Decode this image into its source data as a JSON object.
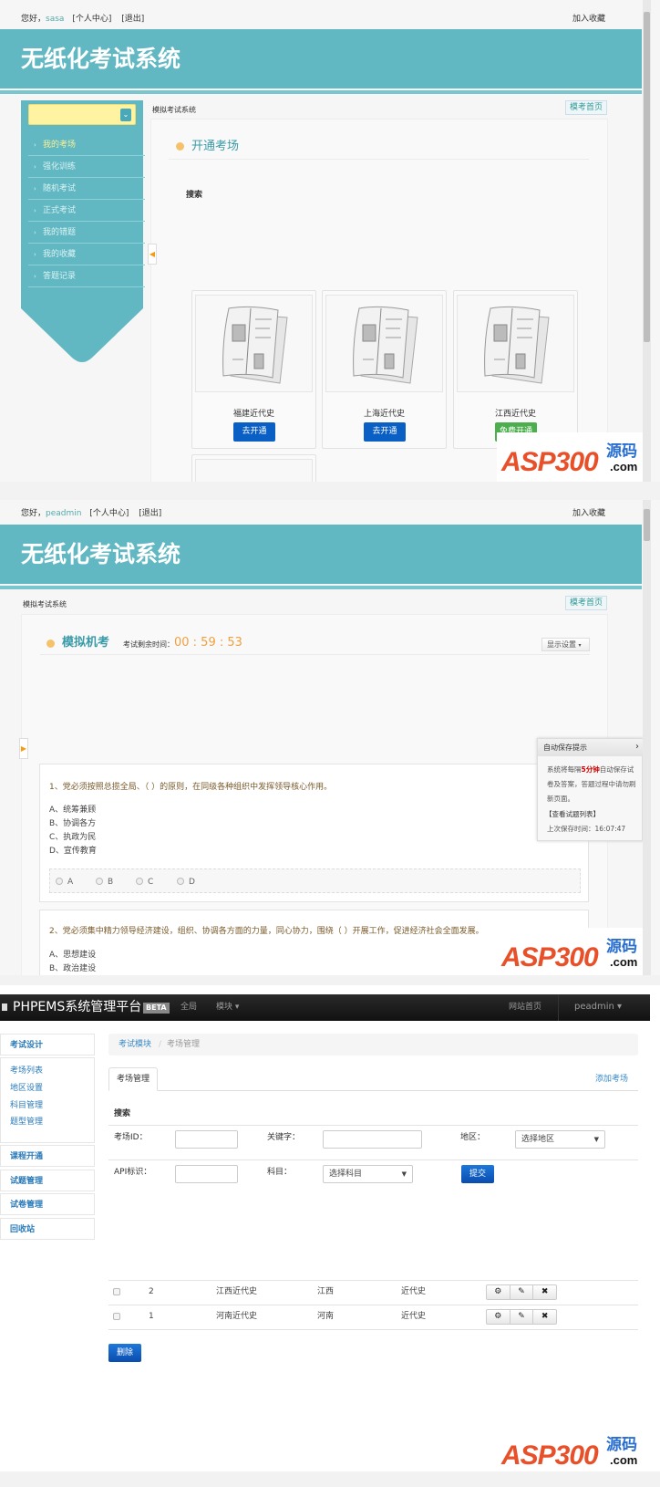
{
  "screen1": {
    "greeting": "您好，",
    "username": "sasa",
    "user_center": "[个人中心]",
    "logout": "[退出]",
    "bookmark": "加入收藏",
    "site_title": "无纸化考试系统",
    "breadcrumb": "模拟考试系统",
    "home_button": "模考首页",
    "sidebar": [
      "我的考场",
      "强化训练",
      "随机考试",
      "正式考试",
      "我的错题",
      "我的收藏",
      "答题记录"
    ],
    "section_title": "开通考场",
    "search_label": "搜索",
    "cards": [
      {
        "name": "福建近代史",
        "button": "去开通",
        "color": "#0a5fc4"
      },
      {
        "name": "上海近代史",
        "button": "去开通",
        "color": "#0a5fc4"
      },
      {
        "name": "江西近代史",
        "button": "免费开通",
        "color": "#4cae4c"
      }
    ]
  },
  "screen2": {
    "greeting": "您好，",
    "username": "peadmin",
    "user_center": "[个人中心]",
    "logout": "[退出]",
    "bookmark": "加入收藏",
    "site_title": "无纸化考试系统",
    "breadcrumb": "模拟考试系统",
    "home_button": "模考首页",
    "section_title": "模拟机考",
    "timer_label": "考试剩余时间：",
    "timer_value": "00 : 59 : 53",
    "display_settings": "显示设置",
    "autosave": {
      "title": "自动保存提示",
      "text_pre": "系统将每隔",
      "text_em": "5分钟",
      "text_post": "自动保存试卷及答案，答题过程中请勿刷新页面。",
      "list_link": "【查看试题列表】",
      "last_saved": "上次保存时间：16:07:47"
    },
    "questions": [
      {
        "text": "1、党必须按照总揽全局、（ ）的原则，在同级各种组织中发挥领导核心作用。",
        "options": [
          "A、统筹兼顾",
          "B、协调各方",
          "C、执政为民",
          "D、宣传教育"
        ],
        "radios": [
          "A",
          "B",
          "C",
          "D"
        ]
      },
      {
        "text": "2、党必须集中精力领导经济建设，组织、协调各方面的力量，同心协力，围绕（ ）开展工作，促进经济社会全面发展。",
        "options": [
          "A、思想建设",
          "B、政治建设"
        ]
      }
    ]
  },
  "screen3": {
    "brand": "PHPEMS系统管理平台",
    "beta": "BETA",
    "nav": [
      "全局",
      "模块 ▾"
    ],
    "nav_right": [
      "网站首页",
      "peadmin ▾"
    ],
    "sidebar_head": "考试设计",
    "sidebar_sub": [
      "考场列表",
      "地区设置",
      "科目管理",
      "题型管理"
    ],
    "sidebar_groups": [
      "课程开通",
      "试题管理",
      "试卷管理",
      "回收站"
    ],
    "breadcrumb": [
      "考试模块",
      "/",
      "考场管理"
    ],
    "tab": "考场管理",
    "add_link": "添加考场",
    "search_title": "搜索",
    "fields": {
      "id_label": "考场ID：",
      "keyword_label": "关键字：",
      "region_label": "地区：",
      "region_select": "选择地区",
      "api_label": "API标识：",
      "subject_label": "科目：",
      "subject_select": "选择科目",
      "submit": "提交"
    },
    "rows": [
      {
        "id": "2",
        "name": "江西近代史",
        "region": "江西",
        "subject": "近代史"
      },
      {
        "id": "1",
        "name": "河南近代史",
        "region": "河南",
        "subject": "近代史"
      }
    ],
    "row_actions": [
      "⚙",
      "✎",
      "✖"
    ],
    "delete": "删除"
  },
  "watermark": {
    "text": "ASP300",
    "sub": "源码",
    "domain": ".com"
  }
}
